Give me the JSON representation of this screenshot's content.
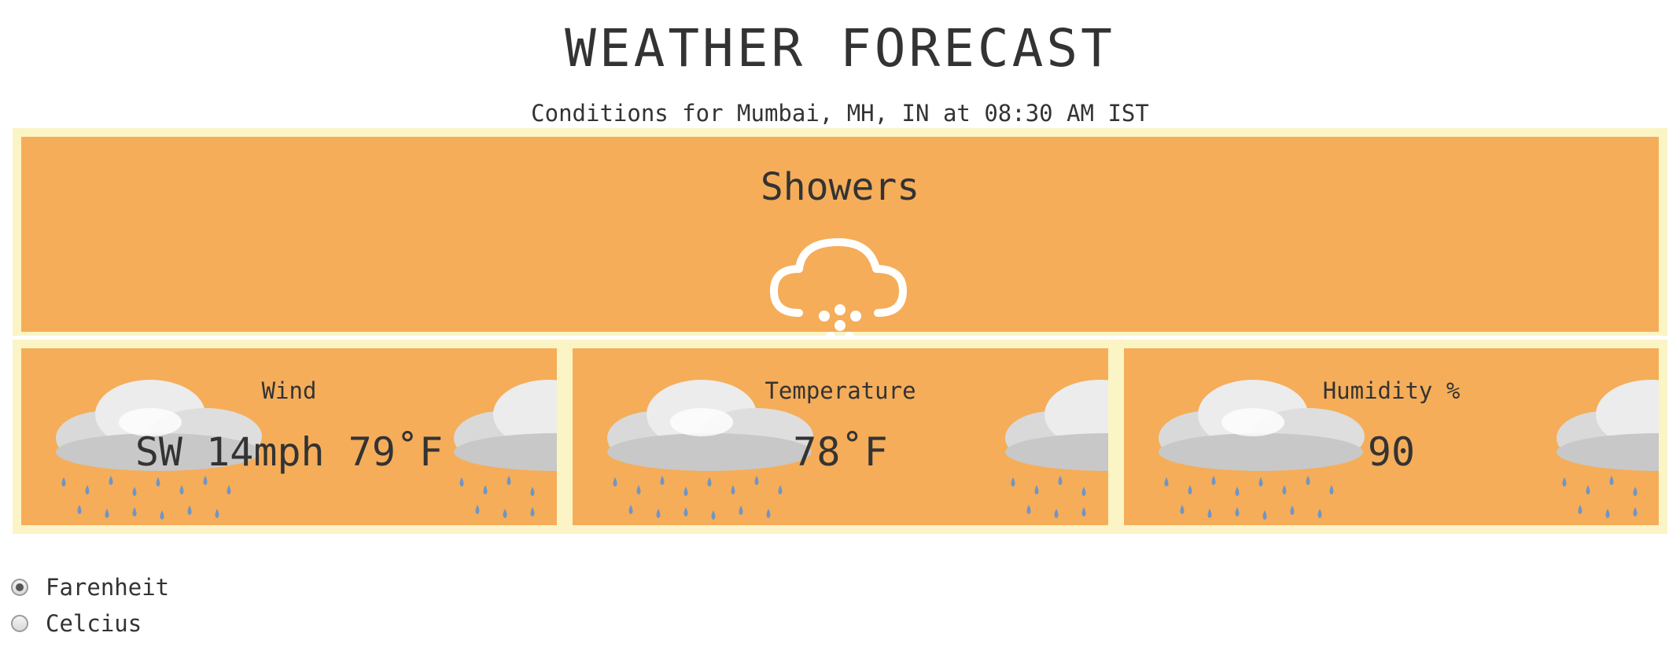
{
  "header": {
    "title": "WEATHER FORECAST",
    "subtitle": "Conditions for Mumbai, MH, IN at 08:30 AM IST"
  },
  "current": {
    "condition": "Showers",
    "icon": "cloud-showers-icon"
  },
  "cards": [
    {
      "label": "Wind",
      "value": "SW 14mph 79˚F",
      "icon": "rain-cloud-icon"
    },
    {
      "label": "Temperature",
      "value": "78˚F",
      "icon": "rain-cloud-icon"
    },
    {
      "label": "Humidity %",
      "value": "90",
      "icon": "rain-cloud-icon"
    }
  ],
  "units": {
    "options": [
      "Farenheit",
      "Celcius"
    ],
    "selected": "Farenheit"
  },
  "colors": {
    "panel": "#f5ad59",
    "frame": "#fbf4c5",
    "text": "#333333"
  }
}
